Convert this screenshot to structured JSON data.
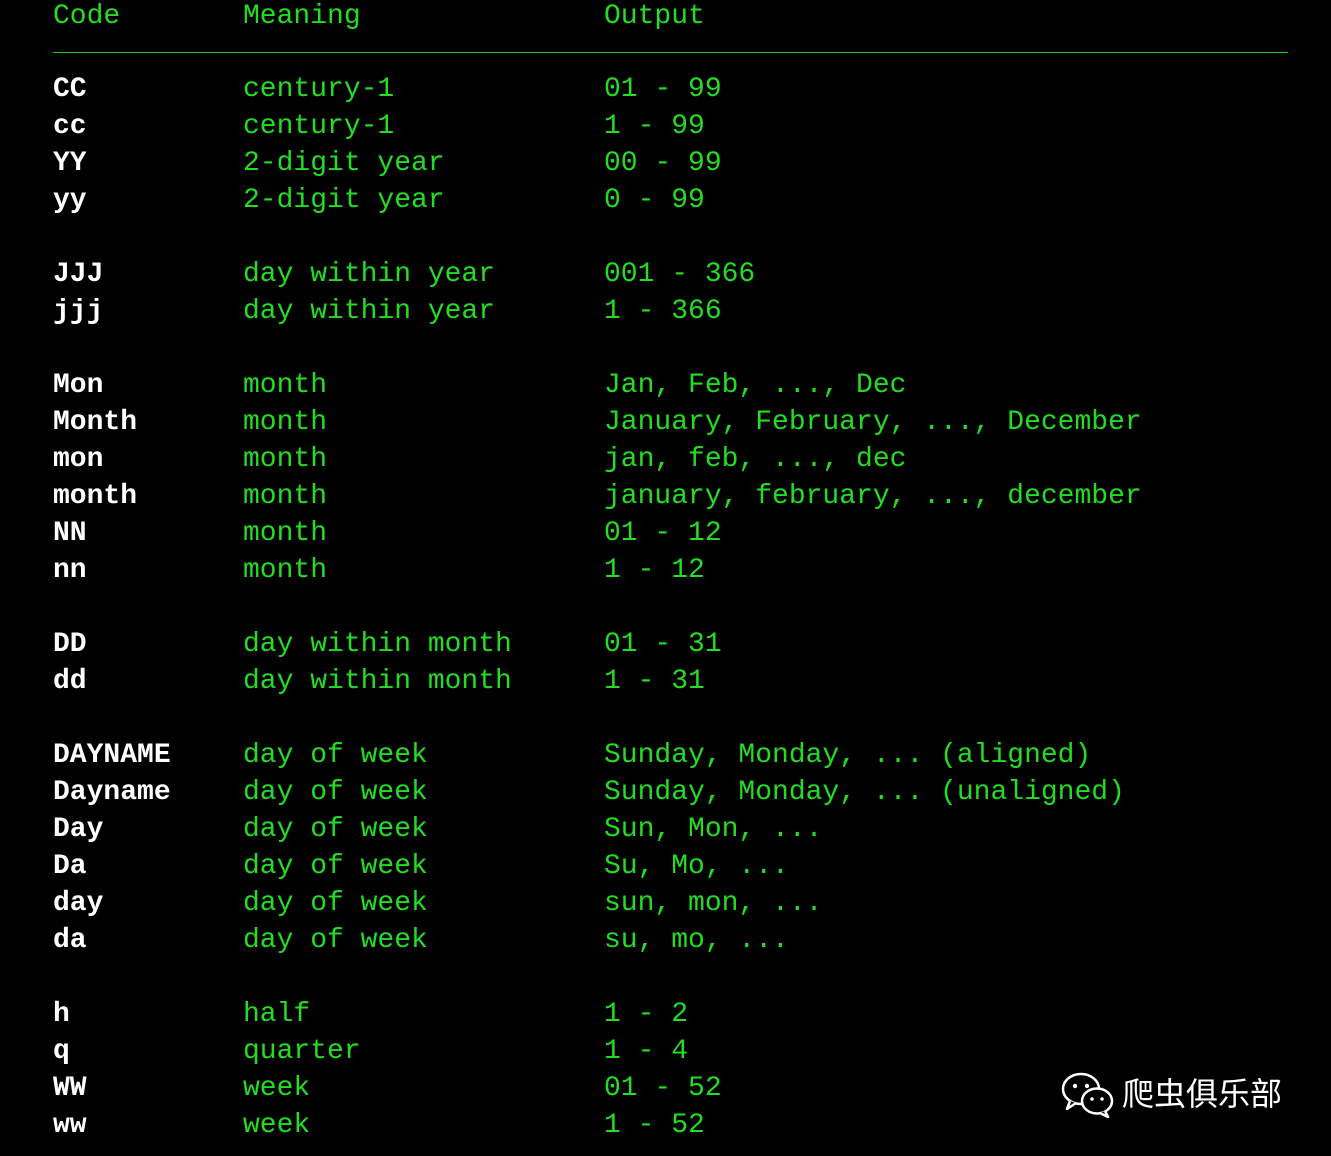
{
  "header": {
    "code": "Code",
    "meaning": "Meaning",
    "output": "Output"
  },
  "groups": [
    {
      "rows": [
        {
          "code": "CC",
          "meaning": "century-1",
          "output": "01 - 99"
        },
        {
          "code": "cc",
          "meaning": "century-1",
          "output": "1 - 99"
        },
        {
          "code": "YY",
          "meaning": "2-digit year",
          "output": "00 - 99"
        },
        {
          "code": "yy",
          "meaning": "2-digit year",
          "output": "0 - 99"
        }
      ]
    },
    {
      "rows": [
        {
          "code": "JJJ",
          "meaning": "day within year",
          "output": "001 - 366"
        },
        {
          "code": "jjj",
          "meaning": "day within year",
          "output": "1 - 366"
        }
      ]
    },
    {
      "rows": [
        {
          "code": "Mon",
          "meaning": "month",
          "output": "Jan, Feb, ..., Dec"
        },
        {
          "code": "Month",
          "meaning": "month",
          "output": "January, February, ..., December"
        },
        {
          "code": "mon",
          "meaning": "month",
          "output": "jan, feb, ..., dec"
        },
        {
          "code": "month",
          "meaning": "month",
          "output": "january, february, ..., december"
        },
        {
          "code": "NN",
          "meaning": "month",
          "output": "01 - 12"
        },
        {
          "code": "nn",
          "meaning": "month",
          "output": "1 - 12"
        }
      ]
    },
    {
      "rows": [
        {
          "code": "DD",
          "meaning": "day within month",
          "output": "01 - 31"
        },
        {
          "code": "dd",
          "meaning": "day within month",
          "output": "1 - 31"
        }
      ]
    },
    {
      "rows": [
        {
          "code": "DAYNAME",
          "meaning": "day of week",
          "output": "Sunday, Monday, ... (aligned)"
        },
        {
          "code": "Dayname",
          "meaning": "day of week",
          "output": "Sunday, Monday, ... (unaligned)"
        },
        {
          "code": "Day",
          "meaning": "day of week",
          "output": "Sun, Mon, ..."
        },
        {
          "code": "Da",
          "meaning": "day of week",
          "output": "Su, Mo, ..."
        },
        {
          "code": "day",
          "meaning": "day of week",
          "output": "sun, mon, ..."
        },
        {
          "code": "da",
          "meaning": "day of week",
          "output": "su, mo, ..."
        }
      ]
    },
    {
      "rows": [
        {
          "code": "h",
          "meaning": "half",
          "output": "1 - 2"
        },
        {
          "code": "q",
          "meaning": "quarter",
          "output": "1 - 4"
        },
        {
          "code": "WW",
          "meaning": "week",
          "output": "01 - 52"
        },
        {
          "code": "ww",
          "meaning": "week",
          "output": "1 - 52"
        }
      ]
    }
  ],
  "watermark": {
    "icon": "wechat-icon",
    "text": "爬虫俱乐部"
  },
  "colors": {
    "background": "#000000",
    "green": "#22dd22",
    "code_text": "#ffffff"
  }
}
